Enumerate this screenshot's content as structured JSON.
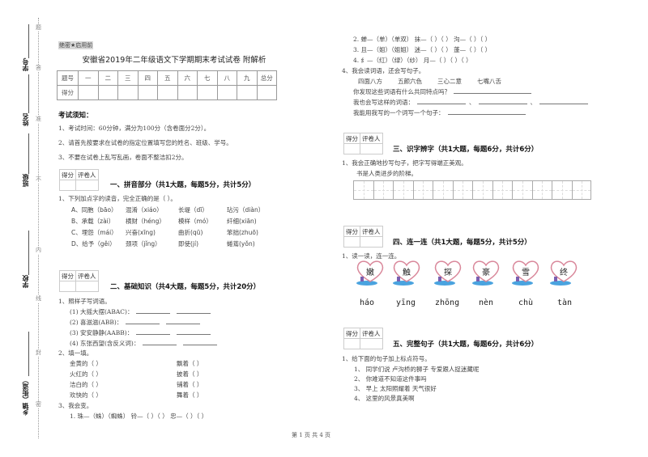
{
  "binding": {
    "labels": [
      "学号",
      "姓名",
      "班级",
      "学校",
      "乡镇（街道）"
    ],
    "dotted_chars": [
      "题",
      "答",
      "准",
      "不",
      "内",
      "线",
      "封",
      "密"
    ]
  },
  "header": {
    "secret_mark": "绝密★启用前",
    "title": "安徽省2019年二年级语文下学期期末考试试卷 附解析"
  },
  "score_table": {
    "row1": [
      "题号",
      "一",
      "二",
      "三",
      "四",
      "五",
      "六",
      "七",
      "八",
      "九",
      "总分"
    ],
    "row2_label": "得分"
  },
  "notice": {
    "heading": "考试须知：",
    "items": [
      "1、考试时间：60分钟，满分为100分（含卷面分2分）。",
      "2、请首先按要求在试卷的指定位置填写您的姓名、班级、学号。",
      "3、不要在试卷上乱写乱画，卷面不整洁扣2分。"
    ]
  },
  "grader_box": {
    "score": "得分",
    "grader": "评卷人"
  },
  "sections": {
    "s1": {
      "heading": "一、拼音部分（共1大题，每题5分，共计5分）",
      "q1": "1、下列加点字的读音，完全正确的是（     ）。",
      "options": [
        [
          "A、同胞（bāo）",
          "混淆（xiáo）",
          "长堤（dī）",
          "玷污（diàn）"
        ],
        [
          "B、承载（zài）",
          "横财（héng）",
          "模样（mó）",
          "纤细(xiān)"
        ],
        [
          "C、埋怨（mái）",
          "兴奋(xīng)",
          "曲折(qū)",
          "笨拙(zhuō)"
        ],
        [
          "D、给予（gěi）",
          "颈项（jǐng）",
          "即使(jí)",
          "蜷蔫(yǒn)"
        ]
      ]
    },
    "s2": {
      "heading": "二、基础知识（共4大题，每题5分，共计20分）",
      "q1": "1、照样子写词语。",
      "q1_items": [
        "(1) 大摇大摆(ABAC)：",
        "(2) 喜滋滋(ABB)：",
        "(3) 安安静静(AABB)：",
        "(4) 东张西望(含反义词)："
      ],
      "q2": "2、填一填。",
      "q2_left": [
        "金黄的（            ）",
        "火红的（            ）",
        "洁白的（            ）",
        "欢快的（            ）"
      ],
      "q2_right": [
        "飘着（            ）",
        "披着（            ）",
        "铺着（            ）",
        "舞着（            ）"
      ],
      "q3": "3、我会变。",
      "q3_lines": [
        "1. 珠—（蛛）（蜘蛛）      铃—（    ）（        ）      忠—（    ）（        ）",
        "2. 蝉—（单）（单双）      抹—（    ）（        ）      沟—（    ）（        ）",
        "3. 且—（姐）（姐姐）      迷—（    ）（        ）      蓬—（    ）（        ）",
        "4. 纟—（红）（绿）（纱）    月—（      ）（      ）（      ）"
      ],
      "q4": "4、我会读词语，还会写句子。",
      "q4_words": [
        "四面八方",
        "五颜六色",
        "三心二意",
        "七嘴八舌"
      ],
      "q4_prompts": [
        "你发现这些词语有什么共同特点吗？",
        "我也会写这样的词语：",
        "我能用我写的一个词写一个句子："
      ]
    },
    "s3": {
      "heading": "三、识字辨字（共1大题，每题6分，共计6分）",
      "q1": "1、我会正确地抄写句子，把字写得端正美观。",
      "sentence": "书是人类进步的阶梯。",
      "grid_cells": 12
    },
    "s4": {
      "heading": "四、连一连（共1大题，每题5分，共计5分）",
      "q1": "1、读一读，连一连。",
      "hearts": [
        "嫩",
        "触",
        "探",
        "豪",
        "雪",
        "终"
      ],
      "pinyin": [
        "háo",
        "yīng",
        "zhōng",
        "nèn",
        "chù",
        "tàn"
      ]
    },
    "s5": {
      "heading": "五、完整句子（共1大题，每题6分，共计6分）",
      "q1": "1、给下面的句子加上标点符号。",
      "items": [
        "1、  同学们说  卢沟桥的狮子  专爱跟人捉迷藏呢",
        "2、  你难道不知道这件事吗",
        "3、  早上    太阳照耀着    天气很好",
        "4、  这里的风景真美啊"
      ]
    }
  },
  "footer": {
    "page": "第 1 页 共 4 页"
  }
}
